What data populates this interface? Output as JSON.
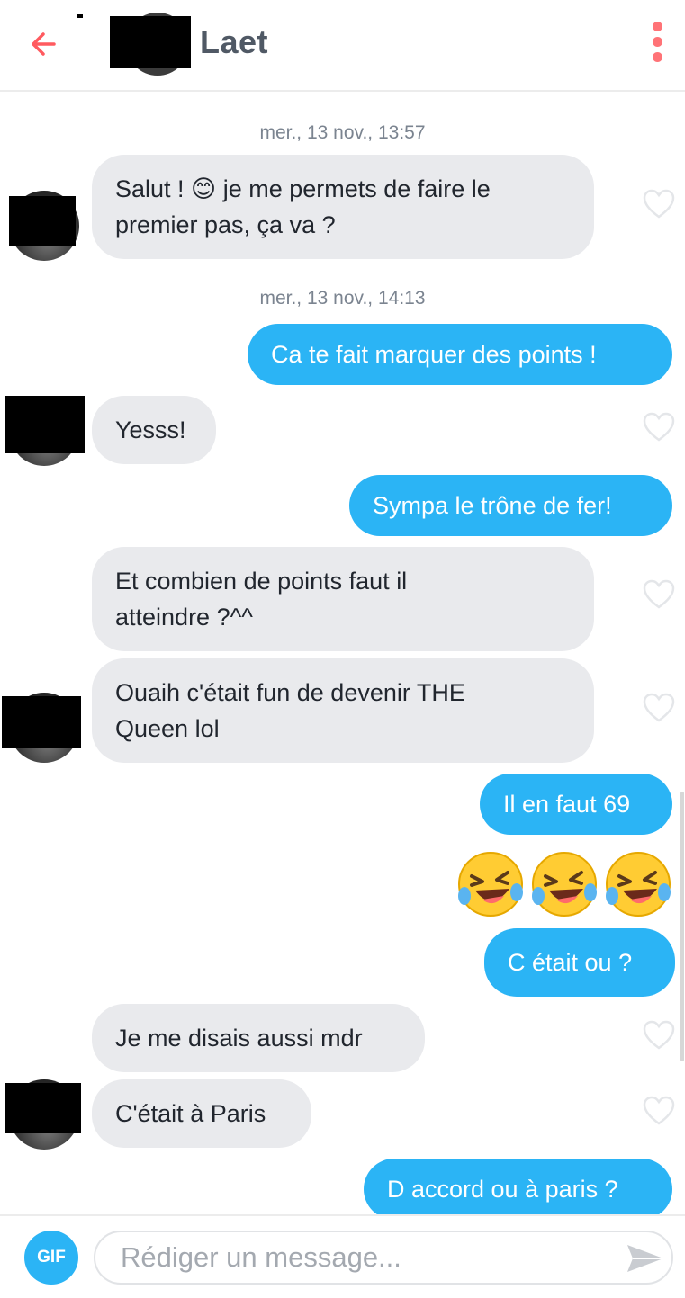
{
  "header": {
    "contact_name": "Laet",
    "back_icon": "arrow-left-icon",
    "more_icon": "vertical-dots-icon",
    "accent_color": "#ff5a5f"
  },
  "conversation": {
    "timestamps": [
      "mer., 13 nov., 13:57",
      "mer., 13 nov., 14:13"
    ],
    "messages": [
      {
        "from": "them",
        "text": "Salut ! 😊 je me permets de faire le\npremier pas, ça va ?"
      },
      {
        "from": "me",
        "text": "Ca te fait marquer des points !"
      },
      {
        "from": "them",
        "text": "Yesss!"
      },
      {
        "from": "me",
        "text": "Sympa le trône de fer!"
      },
      {
        "from": "them",
        "text": "Et combien de points faut il\natteindre ?^^"
      },
      {
        "from": "them",
        "text": "Ouaih c'était fun de devenir THE\nQueen lol"
      },
      {
        "from": "me",
        "text": "Il en faut 69"
      },
      {
        "from": "me",
        "emoji": "🤣🤣🤣"
      },
      {
        "from": "me",
        "text": "C était ou ?"
      },
      {
        "from": "them",
        "text": "Je me disais aussi mdr"
      },
      {
        "from": "them",
        "text": "C'était à Paris"
      },
      {
        "from": "me",
        "text": "D accord ou à paris ?"
      }
    ],
    "incoming_color": "#e9eaed",
    "outgoing_color": "#2bb4f5",
    "like_icon": "heart-outline-icon"
  },
  "composer": {
    "gif_label": "GIF",
    "placeholder": "Rédiger un message...",
    "send_icon": "send-arrow-icon"
  }
}
